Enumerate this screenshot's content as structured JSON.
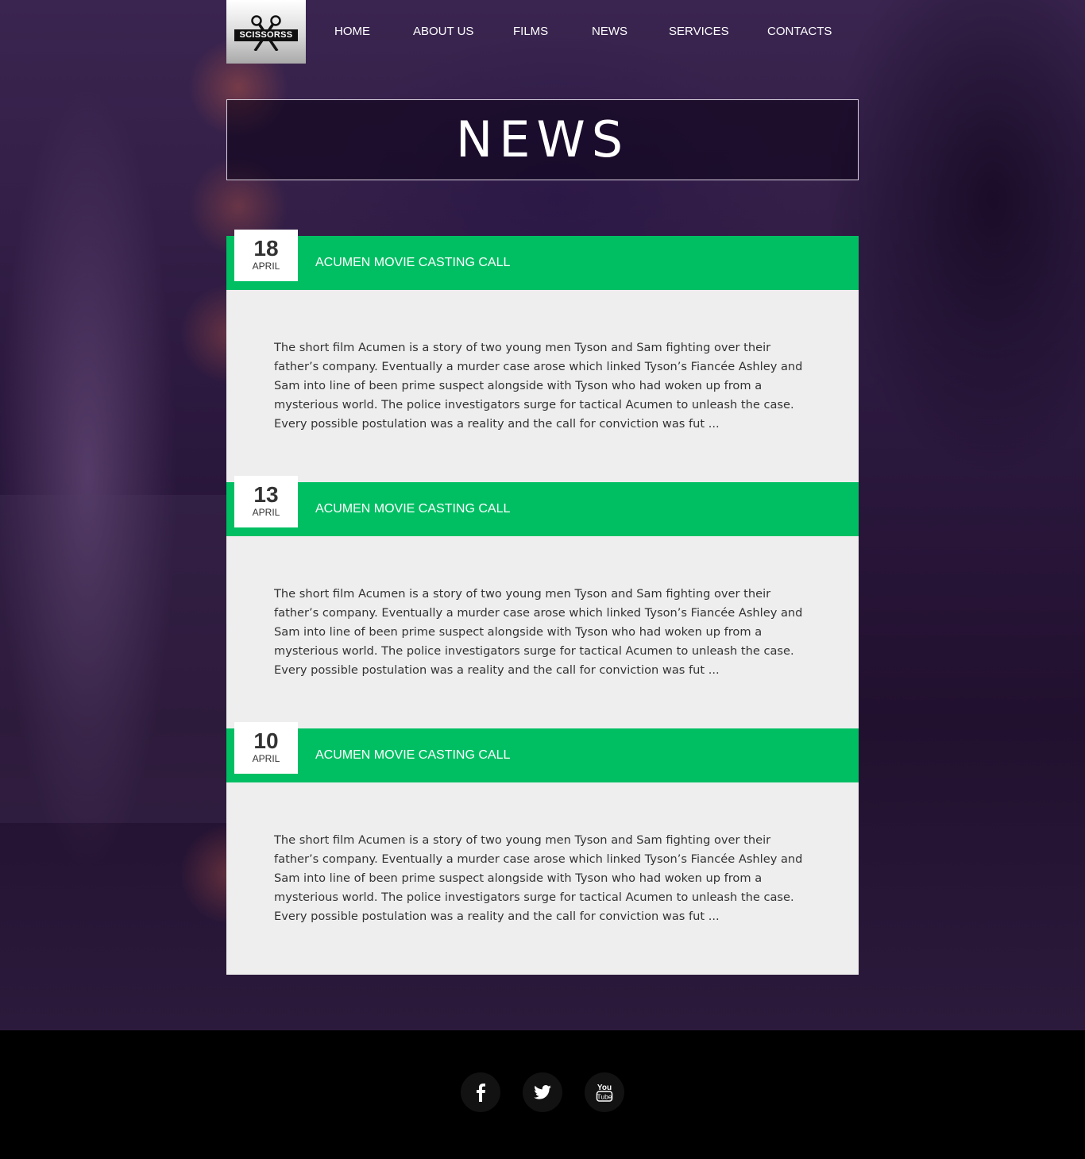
{
  "brand": {
    "logo_text": "SCISSORSS"
  },
  "nav": [
    "HOME",
    "ABOUT US",
    "FILMS",
    "NEWS",
    "SERVICES",
    "CONTACTS"
  ],
  "page": {
    "title": "NEWS"
  },
  "news": [
    {
      "day": "18",
      "month": "APRIL",
      "title": "ACUMEN MOVIE CASTING CALL",
      "excerpt": "The short film Acumen is a story of two young men Tyson and Sam fighting over their father’s company. Eventually a murder case arose which linked Tyson’s Fiancée Ashley and Sam into line of been prime suspect alongside with Tyson who had woken up from a mysterious world. The police investigators surge for tactical Acumen to unleash the case. Every possible postulation was a reality and the call for conviction was fut ..."
    },
    {
      "day": "13",
      "month": "APRIL",
      "title": "ACUMEN MOVIE CASTING CALL",
      "excerpt": "The short film Acumen is a story of two young men Tyson and Sam fighting over their father’s company. Eventually a murder case arose which linked Tyson’s Fiancée Ashley and Sam into line of been prime suspect alongside with Tyson who had woken up from a mysterious world. The police investigators surge for tactical Acumen to unleash the case. Every possible postulation was a reality and the call for conviction was fut ..."
    },
    {
      "day": "10",
      "month": "APRIL",
      "title": "ACUMEN MOVIE CASTING CALL",
      "excerpt": "The short film Acumen is a story of two young men Tyson and Sam fighting over their father’s company. Eventually a murder case arose which linked Tyson’s Fiancée Ashley and Sam into line of been prime suspect alongside with Tyson who had woken up from a mysterious world. The police investigators surge for tactical Acumen to unleash the case. Every possible postulation was a reality and the call for conviction was fut ..."
    }
  ],
  "footer": {
    "social": [
      {
        "icon": "facebook-icon"
      },
      {
        "icon": "twitter-icon"
      },
      {
        "icon": "youtube-icon"
      }
    ]
  },
  "colors": {
    "accent": "#00bf63",
    "card_bg": "#eeeeee",
    "footer_bg": "#000000"
  }
}
